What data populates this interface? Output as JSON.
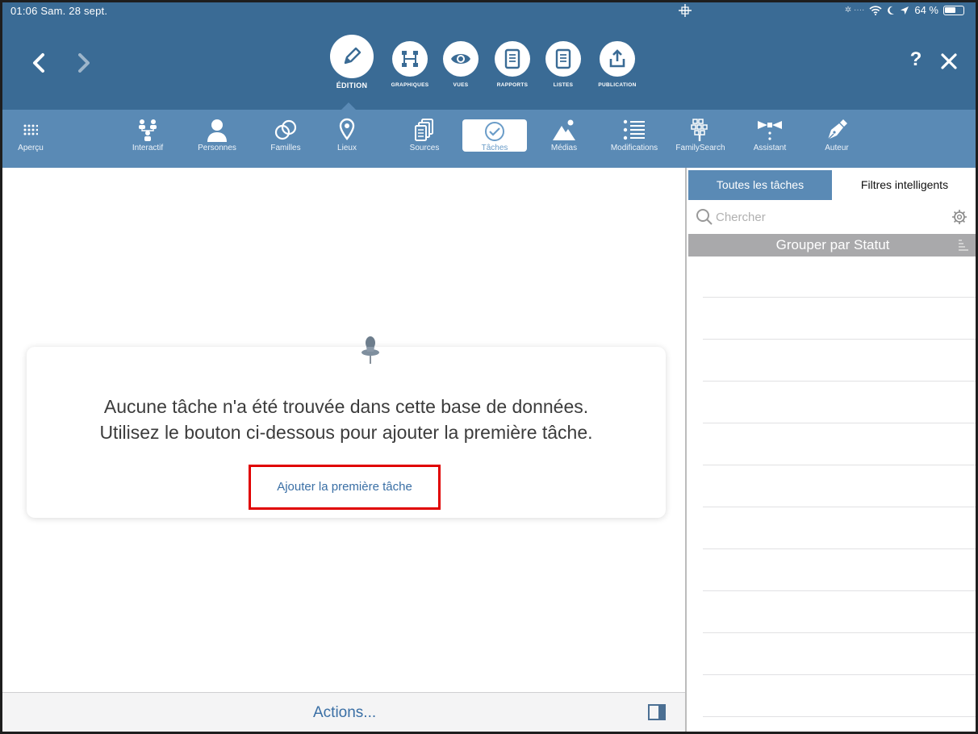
{
  "status_bar": {
    "time": "01:06  Sam. 28 sept.",
    "battery": "64 %",
    "battery_level": 0.64
  },
  "modes": [
    {
      "id": "edition",
      "label": "ÉDITION",
      "icon": "pencil-icon"
    },
    {
      "id": "graphiques",
      "label": "GRAPHIQUES",
      "icon": "chart-icon"
    },
    {
      "id": "vues",
      "label": "VUES",
      "icon": "eye-icon"
    },
    {
      "id": "rapports",
      "label": "RAPPORTS",
      "icon": "document-icon"
    },
    {
      "id": "listes",
      "label": "LISTES",
      "icon": "list-document-icon"
    },
    {
      "id": "publication",
      "label": "PUBLICATION",
      "icon": "upload-icon"
    }
  ],
  "header": {
    "help": "?"
  },
  "toolbar": [
    {
      "id": "apercu",
      "label": "Aperçu",
      "icon": "grid-icon"
    },
    {
      "id": "interactif",
      "label": "Interactif",
      "icon": "tree-icon"
    },
    {
      "id": "personnes",
      "label": "Personnes",
      "icon": "person-icon"
    },
    {
      "id": "familles",
      "label": "Familles",
      "icon": "rings-icon"
    },
    {
      "id": "lieux",
      "label": "Lieux",
      "icon": "pin-icon"
    },
    {
      "id": "sources",
      "label": "Sources",
      "icon": "documents-icon"
    },
    {
      "id": "taches",
      "label": "Tâches",
      "icon": "checkmark-icon",
      "selected": true
    },
    {
      "id": "medias",
      "label": "Médias",
      "icon": "mountain-icon"
    },
    {
      "id": "modifications",
      "label": "Modifications",
      "icon": "list-icon"
    },
    {
      "id": "familysearch",
      "label": "FamilySearch",
      "icon": "familysearch-tree-icon"
    },
    {
      "id": "assistant",
      "label": "Assistant",
      "icon": "bow-tie-icon"
    },
    {
      "id": "auteur",
      "label": "Auteur",
      "icon": "fountain-pen-icon"
    }
  ],
  "main": {
    "empty_line1": "Aucune tâche n'a été trouvée dans cette base de données.",
    "empty_line2": "Utilisez le bouton ci-dessous pour ajouter la première tâche.",
    "add_first_label": "Ajouter la première tâche",
    "actions_label": "Actions..."
  },
  "sidebar": {
    "tab_all": "Toutes les tâches",
    "tab_smart": "Filtres intelligents",
    "search_placeholder": "Chercher",
    "group_label": "Grouper par Statut"
  },
  "colors": {
    "nav": "#3a6b95",
    "toolbar": "#5a8ab5",
    "highlight": "#e00000",
    "link": "#3a6fa5"
  }
}
